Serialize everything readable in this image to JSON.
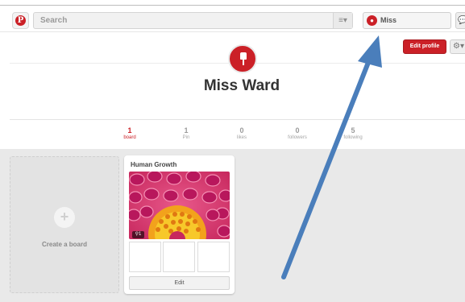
{
  "header": {
    "search_placeholder": "Search",
    "menu_icon": "menu-lines-icon",
    "user_name": "Miss",
    "colors": {
      "brand_red": "#cb2027"
    }
  },
  "profile": {
    "edit_label": "Edit profile",
    "name": "Miss Ward"
  },
  "stats": [
    {
      "value": "1",
      "label": "board",
      "active": true
    },
    {
      "value": "1",
      "label": "Pin"
    },
    {
      "value": "0",
      "label": "likes"
    },
    {
      "value": "0",
      "label": "followers"
    },
    {
      "value": "5",
      "label": "following"
    }
  ],
  "boards": {
    "create_label": "Create a board",
    "items": [
      {
        "title": "Human Growth",
        "pin_count": "1",
        "edit_label": "Edit"
      }
    ]
  },
  "annotation": {
    "color": "#4a7ebb"
  }
}
